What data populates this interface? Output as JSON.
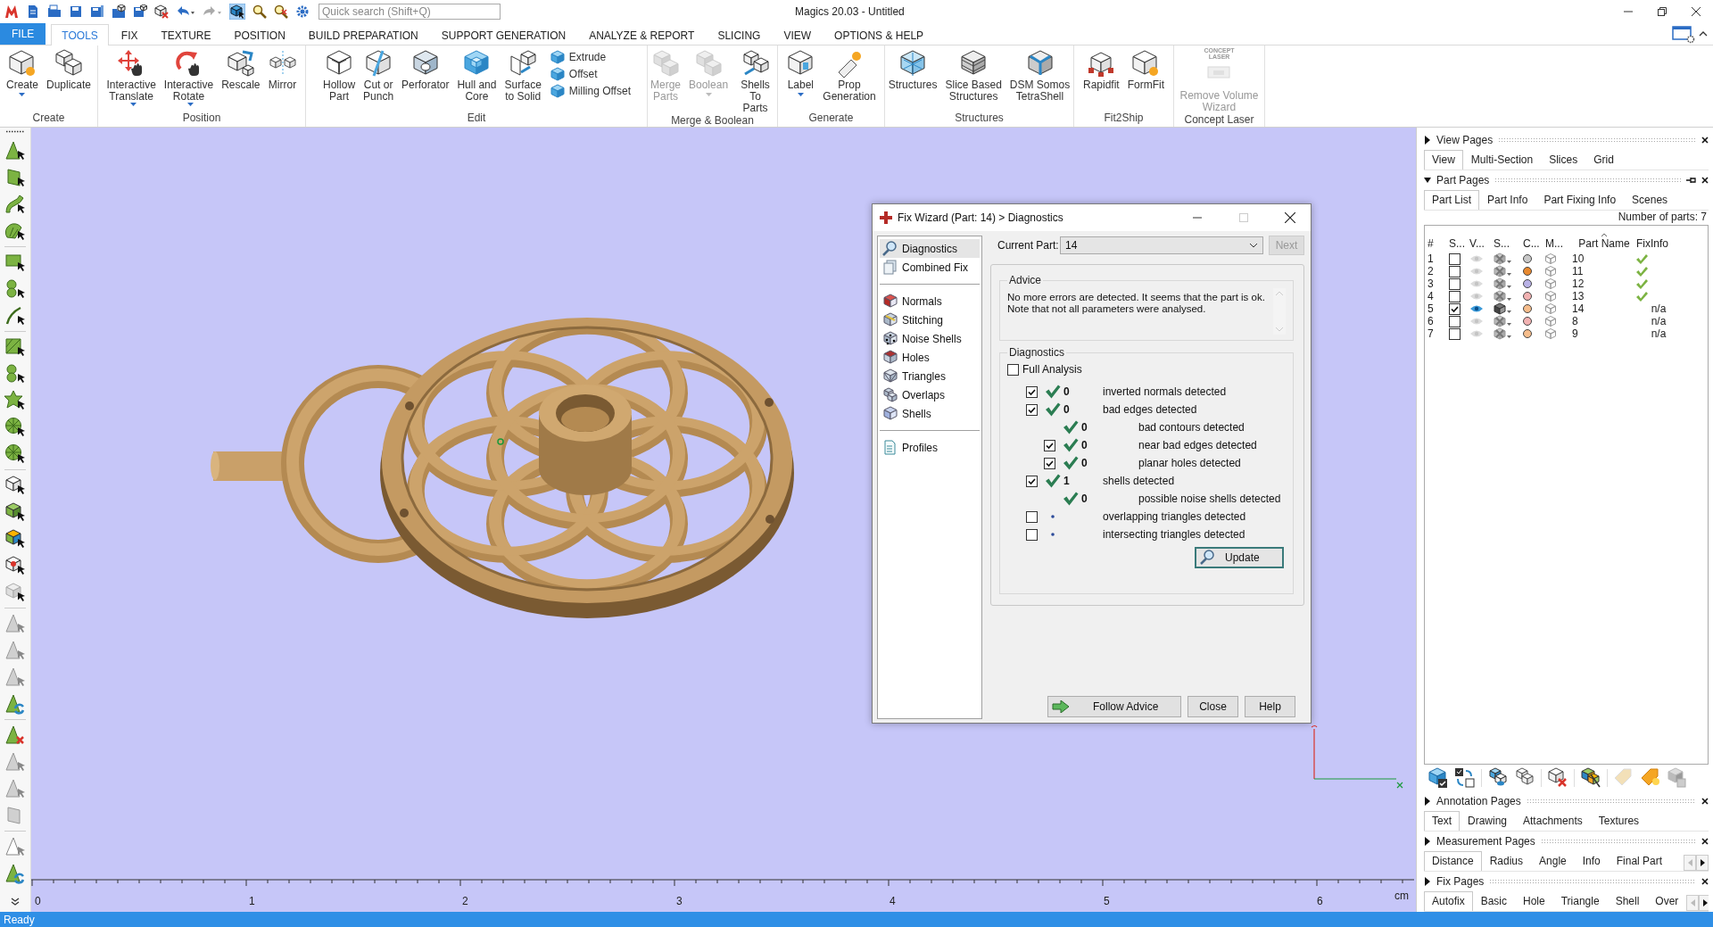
{
  "window": {
    "title": "Magics 20.03 - Untitled"
  },
  "quick_search": {
    "placeholder": "Quick search (Shift+Q)"
  },
  "ribbon": {
    "tabs": [
      {
        "label": "FILE",
        "kind": "file",
        "selected": false
      },
      {
        "label": "TOOLS",
        "kind": "tab",
        "selected": true
      },
      {
        "label": "FIX",
        "kind": "tab",
        "selected": false
      },
      {
        "label": "TEXTURE",
        "kind": "tab",
        "selected": false
      },
      {
        "label": "POSITION",
        "kind": "tab",
        "selected": false
      },
      {
        "label": "BUILD PREPARATION",
        "kind": "tab",
        "selected": false
      },
      {
        "label": "SUPPORT GENERATION",
        "kind": "tab",
        "selected": false
      },
      {
        "label": "ANALYZE & REPORT",
        "kind": "tab",
        "selected": false
      },
      {
        "label": "SLICING",
        "kind": "tab",
        "selected": false
      },
      {
        "label": "VIEW",
        "kind": "tab",
        "selected": false
      },
      {
        "label": "OPTIONS & HELP",
        "kind": "tab",
        "selected": false
      }
    ],
    "groups": [
      {
        "label": "Create",
        "buttons": [
          {
            "label": "Create",
            "kind": "large",
            "dropdown": true,
            "disabled": false
          },
          {
            "label": "Duplicate",
            "kind": "large",
            "dropdown": false,
            "disabled": false
          }
        ]
      },
      {
        "label": "Position",
        "buttons": [
          {
            "label": "Interactive\nTranslate",
            "kind": "large",
            "dropdown": true,
            "disabled": false
          },
          {
            "label": "Interactive\nRotate",
            "kind": "large",
            "dropdown": true,
            "disabled": false
          },
          {
            "label": "Rescale",
            "kind": "large",
            "dropdown": false,
            "disabled": false
          },
          {
            "label": "Mirror",
            "kind": "large",
            "dropdown": false,
            "disabled": false
          }
        ]
      },
      {
        "label": "Edit",
        "buttons": [
          {
            "label": "Hollow\nPart",
            "kind": "large",
            "dropdown": false,
            "disabled": false
          },
          {
            "label": "Cut or\nPunch",
            "kind": "large",
            "dropdown": false,
            "disabled": false
          },
          {
            "label": "Perforator",
            "kind": "large",
            "dropdown": false,
            "disabled": false
          },
          {
            "label": "Hull and\nCore",
            "kind": "large",
            "dropdown": false,
            "disabled": false
          },
          {
            "label": "Surface\nto Solid",
            "kind": "large",
            "dropdown": false,
            "disabled": false
          },
          {
            "label": "Extrude",
            "kind": "small",
            "dropdown": false,
            "disabled": false
          },
          {
            "label": "Offset",
            "kind": "small",
            "dropdown": false,
            "disabled": false
          },
          {
            "label": "Milling Offset",
            "kind": "small",
            "dropdown": false,
            "disabled": false
          }
        ]
      },
      {
        "label": "Merge & Boolean",
        "buttons": [
          {
            "label": "Merge\nParts",
            "kind": "large",
            "dropdown": false,
            "disabled": true
          },
          {
            "label": "Boolean",
            "kind": "large",
            "dropdown": true,
            "disabled": true
          },
          {
            "label": "Shells\nTo Parts",
            "kind": "large",
            "dropdown": false,
            "disabled": false
          }
        ]
      },
      {
        "label": "Generate",
        "buttons": [
          {
            "label": "Label",
            "kind": "large",
            "dropdown": true,
            "disabled": false
          },
          {
            "label": "Prop\nGeneration",
            "kind": "large",
            "dropdown": false,
            "disabled": false
          }
        ]
      },
      {
        "label": "Structures",
        "buttons": [
          {
            "label": "Structures",
            "kind": "large",
            "dropdown": false,
            "disabled": false
          },
          {
            "label": "Slice Based\nStructures",
            "kind": "large",
            "dropdown": false,
            "disabled": false
          },
          {
            "label": "DSM Somos\nTetraShell",
            "kind": "large",
            "dropdown": false,
            "disabled": false
          }
        ]
      },
      {
        "label": "Fit2Ship",
        "buttons": [
          {
            "label": "Rapidfit",
            "kind": "large",
            "dropdown": false,
            "disabled": false
          },
          {
            "label": "FormFit",
            "kind": "large",
            "dropdown": false,
            "disabled": false
          }
        ]
      },
      {
        "label": "Concept Laser",
        "buttons": [
          {
            "label": "Remove Volume\nWizard",
            "kind": "large",
            "dropdown": false,
            "disabled": true,
            "badge": "CONCEPT\nLASER"
          }
        ]
      }
    ]
  },
  "viewport": {
    "ruler": {
      "ticks": [
        "0",
        "1",
        "2",
        "3",
        "4",
        "5",
        "6"
      ],
      "unit": "cm"
    }
  },
  "fix_wizard": {
    "title": "Fix Wizard (Part: 14) > Diagnostics",
    "nav": [
      {
        "items": [
          {
            "label": "Diagnostics",
            "selected": true
          },
          {
            "label": "Combined Fix",
            "selected": false
          }
        ]
      },
      {
        "items": [
          {
            "label": "Normals",
            "selected": false
          },
          {
            "label": "Stitching",
            "selected": false
          },
          {
            "label": "Noise Shells",
            "selected": false
          },
          {
            "label": "Holes",
            "selected": false
          },
          {
            "label": "Triangles",
            "selected": false
          },
          {
            "label": "Overlaps",
            "selected": false
          },
          {
            "label": "Shells",
            "selected": false
          }
        ]
      },
      {
        "items": [
          {
            "label": "Profiles",
            "selected": false
          }
        ]
      }
    ],
    "current_part": {
      "label": "Current Part:",
      "value": "14"
    },
    "next_button": {
      "label": "Next",
      "disabled": true
    },
    "advice": {
      "title": "Advice",
      "text": "No more errors are detected. It seems that the part is ok.\nNote that not all parameters were analysed."
    },
    "diagnostics": {
      "title": "Diagnostics",
      "full_analysis": {
        "label": "Full Analysis",
        "checked": false
      },
      "rows": [
        {
          "kind": "checkbox",
          "checked": true,
          "passed": true,
          "count": "0",
          "label": "inverted normals detected"
        },
        {
          "kind": "checkbox",
          "checked": true,
          "passed": true,
          "count": "0",
          "label": "bad edges detected",
          "children": [
            {
              "kind": "plain",
              "passed": true,
              "count": "0",
              "label": "bad contours detected"
            },
            {
              "kind": "checkbox",
              "checked": true,
              "passed": true,
              "count": "0",
              "label": "near bad edges detected"
            },
            {
              "kind": "checkbox",
              "checked": true,
              "passed": true,
              "count": "0",
              "label": "planar holes detected"
            }
          ]
        },
        {
          "kind": "checkbox",
          "checked": true,
          "passed": true,
          "count": "1",
          "label": "shells detected",
          "children": [
            {
              "kind": "plain",
              "passed": true,
              "count": "0",
              "label": "possible noise shells detected"
            }
          ]
        },
        {
          "kind": "checkbox",
          "checked": false,
          "passed": false,
          "label": "overlapping triangles detected"
        },
        {
          "kind": "checkbox",
          "checked": false,
          "passed": false,
          "label": "intersecting triangles detected"
        }
      ]
    },
    "update_button": {
      "label": "Update"
    },
    "buttons": [
      {
        "label": "Follow Advice",
        "kind": "follow"
      },
      {
        "label": "Close",
        "kind": "plain"
      },
      {
        "label": "Help",
        "kind": "plain"
      }
    ]
  },
  "side_panel": {
    "sections": [
      {
        "title": "View Pages",
        "expanded": false,
        "pin": false,
        "scroll_arrows": false,
        "tabs": [
          {
            "label": "View",
            "selected": true
          },
          {
            "label": "Multi-Section",
            "selected": false
          },
          {
            "label": "Slices",
            "selected": false
          },
          {
            "label": "Grid",
            "selected": false
          }
        ]
      },
      {
        "title": "Part Pages",
        "expanded": true,
        "pin": true,
        "scroll_arrows": false,
        "tabs": [
          {
            "label": "Part List",
            "selected": true
          },
          {
            "label": "Part Info",
            "selected": false
          },
          {
            "label": "Part Fixing Info",
            "selected": false
          },
          {
            "label": "Scenes",
            "selected": false
          }
        ],
        "part_count": "Number of parts: 7",
        "part_list": {
          "columns": [
            {
              "label": "#",
              "sorted": false
            },
            {
              "label": "S...",
              "sorted": false
            },
            {
              "label": "V...",
              "sorted": false
            },
            {
              "label": "S...",
              "sorted": false
            },
            {
              "label": "C...",
              "sorted": false
            },
            {
              "label": "M...",
              "sorted": false
            },
            {
              "label": "Part Name",
              "sorted": true
            },
            {
              "label": "FixInfo",
              "sorted": false
            }
          ],
          "rows": [
            {
              "number": "1",
              "checked": false,
              "visible": false,
              "color": "#c8c8c8",
              "name": "10",
              "fix_ok": true
            },
            {
              "number": "2",
              "checked": false,
              "visible": false,
              "color": "#e8892f",
              "name": "11",
              "fix_ok": true
            },
            {
              "number": "3",
              "checked": false,
              "visible": false,
              "color": "#b9b2e6",
              "name": "12",
              "fix_ok": true
            },
            {
              "number": "4",
              "checked": false,
              "visible": false,
              "color": "#f2b2b2",
              "name": "13",
              "fix_ok": true
            },
            {
              "number": "5",
              "checked": true,
              "visible": true,
              "color": "#f6bd8c",
              "name": "14",
              "fix_ok": false,
              "fix_info": "n/a"
            },
            {
              "number": "6",
              "checked": false,
              "visible": false,
              "color": "#f2b2b2",
              "name": "8",
              "fix_ok": false,
              "fix_info": "n/a"
            },
            {
              "number": "7",
              "checked": false,
              "visible": false,
              "color": "#f6bd8c",
              "name": "9",
              "fix_ok": false,
              "fix_info": "n/a"
            }
          ]
        }
      },
      {
        "title": "Annotation Pages",
        "expanded": false,
        "pin": false,
        "scroll_arrows": false,
        "tabs": [
          {
            "label": "Text",
            "selected": true
          },
          {
            "label": "Drawing",
            "selected": false
          },
          {
            "label": "Attachments",
            "selected": false
          },
          {
            "label": "Textures",
            "selected": false
          }
        ]
      },
      {
        "title": "Measurement Pages",
        "expanded": false,
        "pin": false,
        "scroll_arrows": true,
        "tabs": [
          {
            "label": "Distance",
            "selected": true
          },
          {
            "label": "Radius",
            "selected": false
          },
          {
            "label": "Angle",
            "selected": false
          },
          {
            "label": "Info",
            "selected": false
          },
          {
            "label": "Final Part",
            "selected": false
          }
        ]
      },
      {
        "title": "Fix Pages",
        "expanded": false,
        "pin": false,
        "scroll_arrows": true,
        "tabs": [
          {
            "label": "Autofix",
            "selected": true
          },
          {
            "label": "Basic",
            "selected": false
          },
          {
            "label": "Hole",
            "selected": false
          },
          {
            "label": "Triangle",
            "selected": false
          },
          {
            "label": "Shell",
            "selected": false
          },
          {
            "label": "Over",
            "selected": false
          }
        ]
      }
    ]
  },
  "status_bar": {
    "text": "Ready"
  }
}
